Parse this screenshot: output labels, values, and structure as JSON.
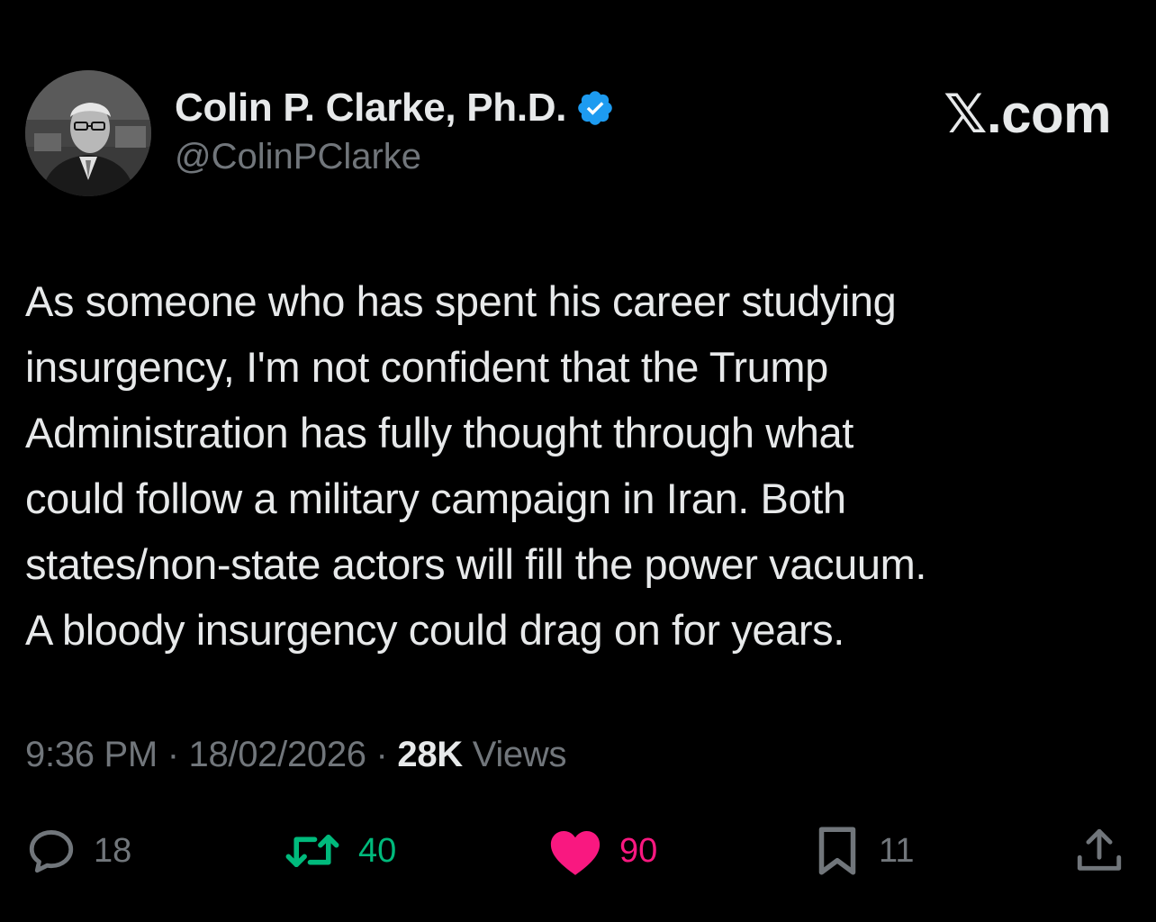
{
  "author": {
    "display_name": "Colin P. Clarke, Ph.D.",
    "handle": "@ColinPClarke",
    "verified": true
  },
  "brand": "𝕏.com",
  "tweet": {
    "text": "As someone who has spent his career studying\ninsurgency, I'm not confident that the Trump\nAdministration has fully thought through what\ncould follow a military campaign in Iran. Both\nstates/non-state actors will fill the power vacuum.\nA bloody insurgency could drag on for years."
  },
  "meta": {
    "time": "9:36 PM",
    "separator": " · ",
    "date": "18/02/2026",
    "views_count": "28K",
    "views_label": " Views"
  },
  "actions": {
    "reply": {
      "count": "18",
      "icon": "speech-bubble-icon"
    },
    "repost": {
      "count": "40",
      "icon": "repost-arrows-icon",
      "color": "#00ba7c"
    },
    "like": {
      "count": "90",
      "icon": "heart-icon",
      "color": "#f91880"
    },
    "bookmark": {
      "count": "11",
      "icon": "bookmark-icon"
    },
    "share": {
      "icon": "share-icon"
    }
  },
  "colors": {
    "background": "#000000",
    "text_primary": "#e7e9ea",
    "text_secondary": "#71767b",
    "verified": "#1d9bf0",
    "repost": "#00ba7c",
    "like": "#f91880"
  }
}
